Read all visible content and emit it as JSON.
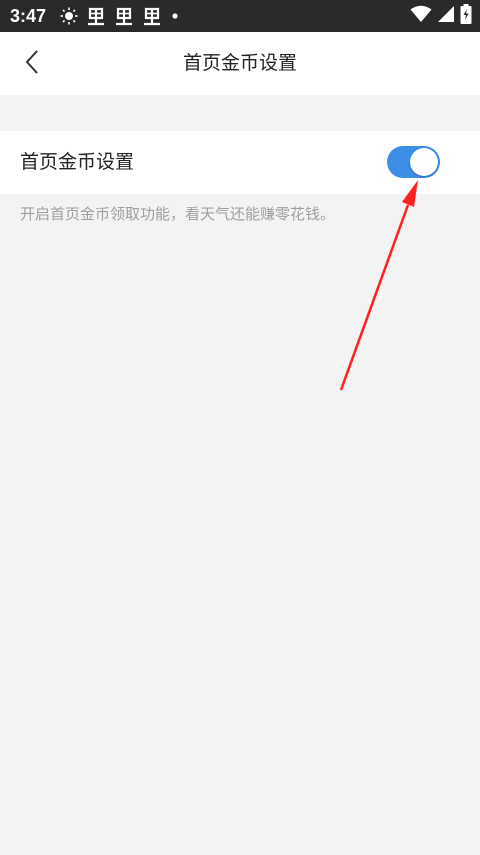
{
  "status_bar": {
    "time": "3:47",
    "left_icons": [
      "sun-icon",
      "app-notification-icon",
      "app-notification-icon",
      "app-notification-icon",
      "dot-icon"
    ],
    "right_icons": [
      "wifi-icon",
      "signal-icon",
      "battery-charging-icon"
    ]
  },
  "nav": {
    "back_icon": "chevron-left-icon",
    "title": "首页金币设置"
  },
  "setting": {
    "label": "首页金币设置",
    "toggle_on": true,
    "description": "开启首页金币领取功能，看天气还能赚零花钱。"
  },
  "colors": {
    "toggle_on": "#3d8ee6",
    "background": "#f3f3f3",
    "status_bar": "#2a2a2a",
    "annotation_arrow": "#ff2020"
  }
}
